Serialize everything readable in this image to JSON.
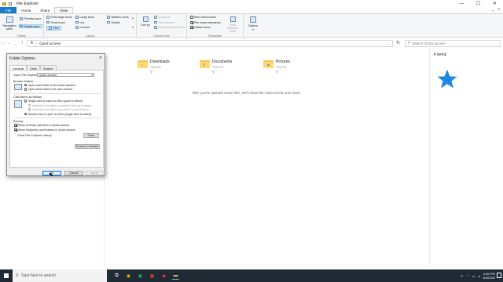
{
  "window": {
    "title": "File Explorer"
  },
  "ribbon_tabs": [
    "File",
    "Home",
    "Share",
    "View"
  ],
  "ribbon": {
    "panes": {
      "navigation_pane": "Navigation pane",
      "preview_pane": "Preview pane",
      "details_pane": "Details pane",
      "label": "Panes"
    },
    "layout": {
      "items": [
        "Extra large icons",
        "Large icons",
        "Medium icons",
        "Small icons",
        "List",
        "Details",
        "Tiles",
        "Content"
      ],
      "label": "Layout"
    },
    "current_view": {
      "sort_by": "Sort by",
      "group_by": "Group by",
      "add_columns": "Add columns",
      "size_all": "Size all columns to fit",
      "label": "Current view"
    },
    "show_hide": {
      "item_check_boxes": "Item check boxes",
      "file_name_extensions": "File name extensions",
      "hidden_items": "Hidden items",
      "hide_selected": "Hide selected items",
      "label": "Show/hide"
    },
    "options": {
      "label": "Options"
    }
  },
  "address": {
    "path": "Quick access",
    "search_placeholder": "Search Quick access"
  },
  "folders": [
    {
      "name": "Downloads",
      "location": "This PC",
      "glyph": "↓"
    },
    {
      "name": "Documents",
      "location": "This PC",
      "glyph": "≡"
    },
    {
      "name": "Pictures",
      "location": "This PC",
      "glyph": "▲"
    }
  ],
  "recent_message": "After you've opened some files, we'll show the most recent ones here.",
  "details_pane": {
    "item_count": "4 items"
  },
  "dialog": {
    "title": "Folder Options",
    "tabs": [
      "General",
      "View",
      "Search"
    ],
    "open_explorer_label": "Open File Explorer to:",
    "open_explorer_value": "Quick access",
    "browse_folders_label": "Browse folders",
    "browse_same": "Open each folder in the same window",
    "browse_own": "Open each folder in its own window",
    "click_label": "Click items as follows",
    "single_click": "Single-click to open an item (point to select)",
    "underline_browser": "Underline icon titles consistent with my browser",
    "underline_point": "Underline icon titles only when I point at them",
    "double_click": "Double-click to open an item (single-click to select)",
    "privacy_label": "Privacy",
    "show_recent": "Show recently used files in Quick access",
    "show_frequent": "Show frequently used folders in Quick access",
    "clear_history": "Clear File Explorer history",
    "clear_btn": "Clear",
    "restore_btn": "Restore Defaults",
    "ok_btn": "OK",
    "cancel_btn": "Cancel",
    "apply_btn": "Apply"
  },
  "taskbar": {
    "search_placeholder": "Type here to search",
    "time": "4:45 PM",
    "date": "5/4/2020"
  },
  "colors": {
    "accent": "#1979ca",
    "taskbar": "#1f2a35",
    "folder": "#ffd86e",
    "quick_access_star": "#1e88e5"
  }
}
